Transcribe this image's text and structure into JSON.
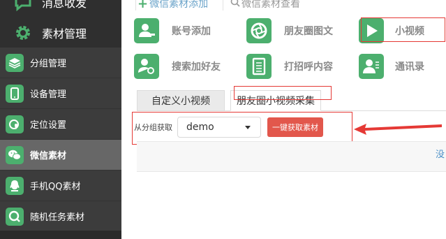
{
  "sidebar": {
    "top_items": [
      {
        "label": "消息收发",
        "icon": "chat-icon"
      },
      {
        "label": "素材管理",
        "icon": "gear-icon"
      }
    ],
    "items": [
      {
        "label": "分组管理",
        "icon": "layers-icon"
      },
      {
        "label": "设备管理",
        "icon": "phone-icon"
      },
      {
        "label": "定位设置",
        "icon": "location-icon"
      },
      {
        "label": "微信素材",
        "icon": "wechat-icon",
        "active": true
      },
      {
        "label": "手机QQ素材",
        "icon": "qq-icon"
      },
      {
        "label": "随机任务素材",
        "icon": "task-icon"
      }
    ]
  },
  "top_tabs": {
    "add_label": "微信素材添加",
    "view_label": "微信素材查看"
  },
  "features": [
    {
      "label": "账号添加",
      "icon": "add-user-icon"
    },
    {
      "label": "朋友圈图文",
      "icon": "camera-shutter-icon"
    },
    {
      "label": "小视频",
      "icon": "play-icon"
    },
    {
      "label": "搜索加好友",
      "icon": "search-user-icon"
    },
    {
      "label": "打招呼内容",
      "icon": "document-icon"
    },
    {
      "label": "通讯录",
      "icon": "contacts-icon"
    }
  ],
  "sub_tabs": {
    "custom": "自定义小视频",
    "moments": "朋友圈小视频采集"
  },
  "fetch": {
    "label": "从分组获取",
    "selected": "demo",
    "button": "一键获取素材"
  },
  "cut_text": "没",
  "colors": {
    "accent_green": "#4caf6e",
    "highlight_red": "#e53935",
    "button_red": "#e2574c",
    "sidebar_bg": "#3c3c3c"
  }
}
